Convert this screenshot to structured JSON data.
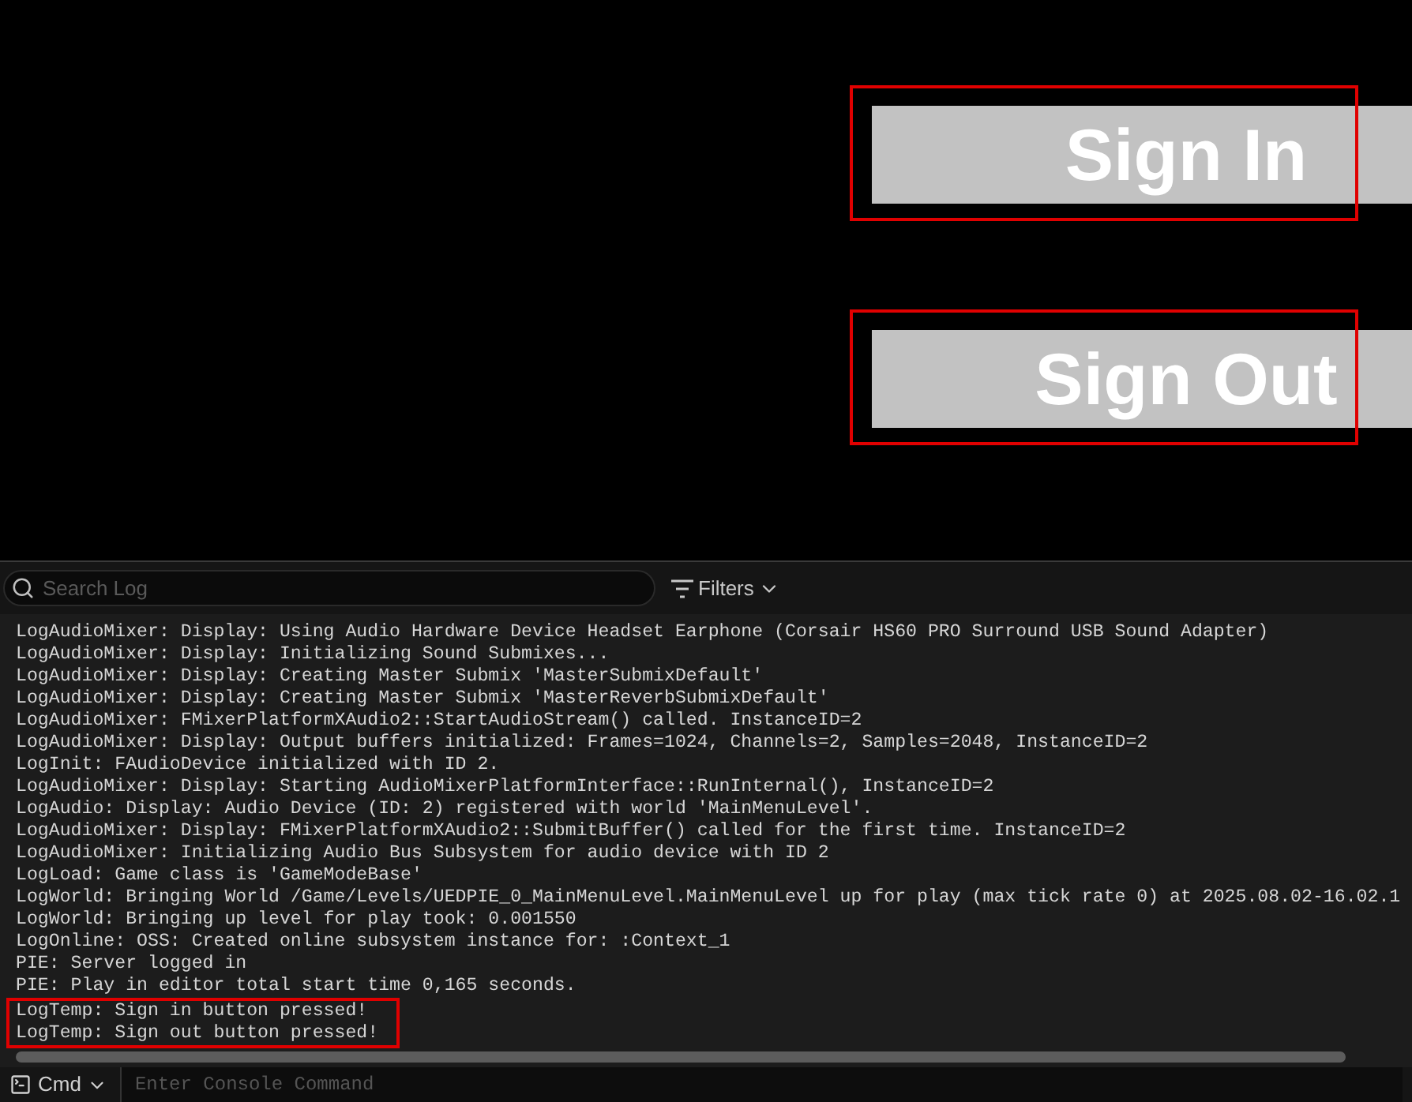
{
  "buttons": [
    {
      "label": "Sign In",
      "highlighted": true
    },
    {
      "label": "Sign Out",
      "highlighted": true
    }
  ],
  "log_panel": {
    "search": {
      "placeholder": "Search Log"
    },
    "filters": "Filters",
    "lines": [
      {
        "text": "LogAudioMixer: Display: Using Audio Hardware Device Headset Earphone (Corsair HS60 PRO Surround USB Sound Adapter)",
        "highlighted": false
      },
      {
        "text": "LogAudioMixer: Display: Initializing Sound Submixes...",
        "highlighted": false
      },
      {
        "text": "LogAudioMixer: Display: Creating Master Submix 'MasterSubmixDefault'",
        "highlighted": false
      },
      {
        "text": "LogAudioMixer: Display: Creating Master Submix 'MasterReverbSubmixDefault'",
        "highlighted": false
      },
      {
        "text": "LogAudioMixer: FMixerPlatformXAudio2::StartAudioStream() called. InstanceID=2",
        "highlighted": false
      },
      {
        "text": "LogAudioMixer: Display: Output buffers initialized: Frames=1024, Channels=2, Samples=2048, InstanceID=2",
        "highlighted": false
      },
      {
        "text": "LogInit: FAudioDevice initialized with ID 2.",
        "highlighted": false
      },
      {
        "text": "LogAudioMixer: Display: Starting AudioMixerPlatformInterface::RunInternal(), InstanceID=2",
        "highlighted": false
      },
      {
        "text": "LogAudio: Display: Audio Device (ID: 2) registered with world 'MainMenuLevel'.",
        "highlighted": false
      },
      {
        "text": "LogAudioMixer: Display: FMixerPlatformXAudio2::SubmitBuffer() called for the first time. InstanceID=2",
        "highlighted": false
      },
      {
        "text": "LogAudioMixer: Initializing Audio Bus Subsystem for audio device with ID 2",
        "highlighted": false
      },
      {
        "text": "LogLoad: Game class is 'GameModeBase'",
        "highlighted": false
      },
      {
        "text": "LogWorld: Bringing World /Game/Levels/UEDPIE_0_MainMenuLevel.MainMenuLevel up for play (max tick rate 0) at 2025.08.02-16.02.1",
        "highlighted": false
      },
      {
        "text": "LogWorld: Bringing up level for play took: 0.001550",
        "highlighted": false
      },
      {
        "text": "LogOnline: OSS: Created online subsystem instance for: :Context_1",
        "highlighted": false
      },
      {
        "text": "PIE: Server logged in",
        "highlighted": false
      },
      {
        "text": "PIE: Play in editor total start time 0,165 seconds.",
        "highlighted": false
      },
      {
        "text": "LogTemp: Sign in button pressed!",
        "highlighted": true
      },
      {
        "text": "LogTemp: Sign out button pressed!",
        "highlighted": true
      }
    ],
    "console": {
      "mode": "Cmd",
      "placeholder": "Enter Console Command"
    }
  }
}
